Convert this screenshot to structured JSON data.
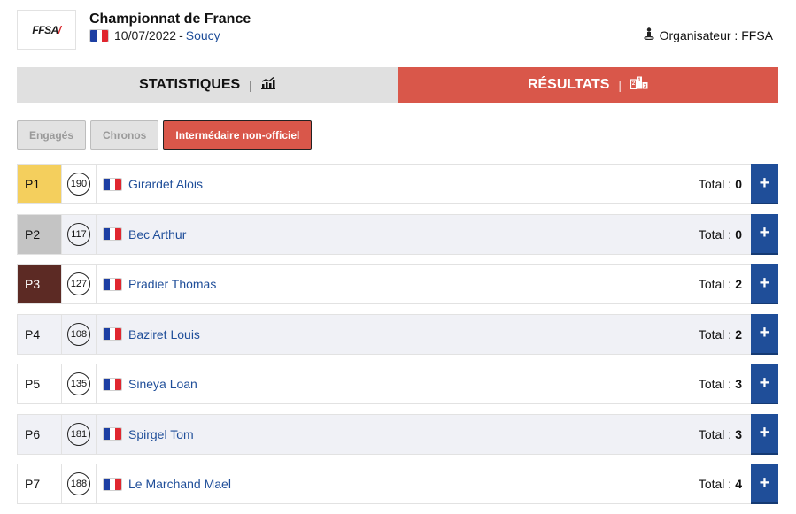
{
  "header": {
    "logo_text": "FFSA",
    "title": "Championnat de France",
    "date": "10/07/2022",
    "separator": "-",
    "location": "Soucy",
    "country_flag": "france-flag",
    "organiser_icon": "person-icon",
    "organiser_label": "Organisateur : FFSA"
  },
  "tabs": [
    {
      "label": "STATISTIQUES",
      "icon": "bar-chart-icon",
      "active": false
    },
    {
      "label": "RÉSULTATS",
      "icon": "podium-icon",
      "active": true
    }
  ],
  "tab_separator": "|",
  "filters": [
    {
      "label": "Engagés",
      "active": false
    },
    {
      "label": "Chronos",
      "active": false
    },
    {
      "label": "Intermédaire non-officiel",
      "active": true
    }
  ],
  "total_label": "Total :",
  "results": [
    {
      "position": "P1",
      "number": "190",
      "name": "Girardet Alois",
      "total": "0",
      "country": "France"
    },
    {
      "position": "P2",
      "number": "117",
      "name": "Bec Arthur",
      "total": "0",
      "country": "France"
    },
    {
      "position": "P3",
      "number": "127",
      "name": "Pradier Thomas",
      "total": "2",
      "country": "France"
    },
    {
      "position": "P4",
      "number": "108",
      "name": "Baziret Louis",
      "total": "2",
      "country": "France"
    },
    {
      "position": "P5",
      "number": "135",
      "name": "Sineya Loan",
      "total": "3",
      "country": "France"
    },
    {
      "position": "P6",
      "number": "181",
      "name": "Spirgel Tom",
      "total": "3",
      "country": "France"
    },
    {
      "position": "P7",
      "number": "188",
      "name": "Le Marchand Mael",
      "total": "4",
      "country": "France"
    }
  ],
  "expand_symbol": "+",
  "colors": {
    "accent_red": "#d9574a",
    "link_blue": "#1f4e99",
    "gold": "#f4cf5d",
    "silver": "#c4c4c4",
    "bronze": "#5c2a24"
  }
}
